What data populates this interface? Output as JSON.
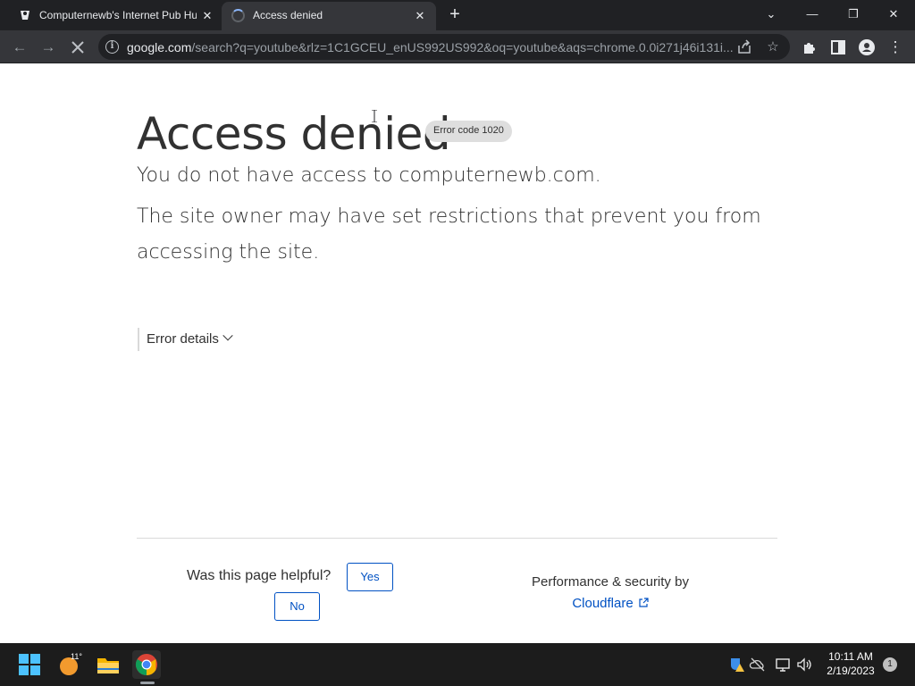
{
  "browser": {
    "tabs": [
      {
        "title": "Computernewb's Internet Pub Hub",
        "close": "✕"
      },
      {
        "title": "Access denied",
        "close": "✕"
      }
    ],
    "new_tab": "+",
    "address": {
      "host": "google.com",
      "path": "/search?q=youtube&rlz=1C1GCEU_enUS992US992&oq=youtube&aqs=chrome.0.0i271j46i131i...",
      "info_glyph": "i"
    },
    "toolbar_icons": [
      "back-icon",
      "forward-icon",
      "stop-icon",
      "share-icon",
      "star-icon",
      "extensions-icon",
      "side-panel-icon",
      "profile-icon",
      "menu-icon"
    ]
  },
  "page": {
    "heading": "Access denied",
    "badge": "Error code 1020",
    "lead": "You do not have access to computernewb.com.",
    "description": "The site owner may have set restrictions that prevent you from accessing the site.",
    "details": "Error details",
    "feedback": {
      "question": "Was this page helpful?",
      "yes": "Yes",
      "no": "No"
    },
    "footer": {
      "perf": "Performance & security by",
      "provider": "Cloudflare"
    },
    "colors": {
      "text": "#313131",
      "link": "#0051c3"
    }
  },
  "taskbar": {
    "weather_temp": "11°",
    "time": "10:11 AM",
    "date": "2/19/2023",
    "notifications": "1",
    "apps": [
      "windows-start-icon",
      "weather-icon",
      "file-explorer-icon",
      "chrome-icon"
    ]
  }
}
